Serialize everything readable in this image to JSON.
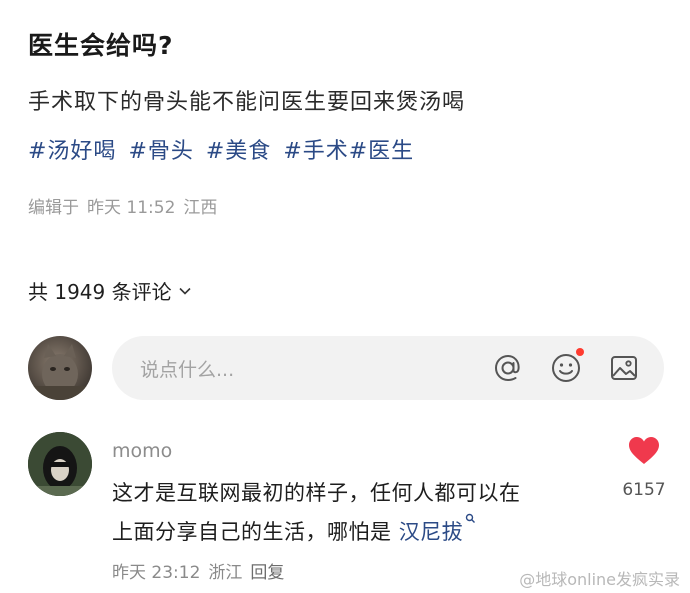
{
  "post": {
    "title": "医生会给吗?",
    "body": "手术取下的骨头能不能问医生要回来煲汤喝",
    "tags": [
      "#汤好喝",
      "#骨头",
      "#美食",
      "#手术#医生"
    ],
    "meta": {
      "edited": "编辑于",
      "time": "昨天 11:52",
      "location": "江西"
    }
  },
  "comments_header": {
    "label": "共 1949 条评论"
  },
  "input": {
    "placeholder": "说点什么..."
  },
  "comment": {
    "username": "momo",
    "text_line1": "这才是互联网最初的样子，任何人都可以在",
    "text_line2": "上面分享自己的生活，哪怕是",
    "link_text": "汉尼拔",
    "time": "昨天 23:12",
    "location": "浙江",
    "reply_label": "回复",
    "likes": "6157"
  },
  "watermark": "@地球online发疯实录",
  "colors": {
    "accent_blue": "#2b4a86",
    "like_red": "#f0394d",
    "notify_dot": "#ff3b30"
  }
}
